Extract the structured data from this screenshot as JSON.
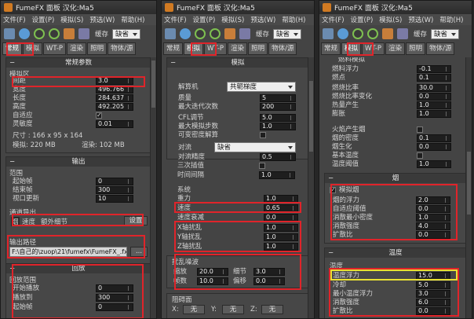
{
  "app": {
    "title": "FumeFX 面板  汉化:Ma5",
    "menus": [
      "文件(F)",
      "设置(P)",
      "模拟(S)",
      "预选(W)",
      "帮助(H)"
    ],
    "cache_label": "缓存",
    "cache_value": "缺省",
    "tabs": [
      "常规",
      "模拟",
      "WT-P",
      "渲染",
      "照明",
      "物体/源"
    ]
  },
  "panel1": {
    "header": "常规参数",
    "grid_label": "模拟区",
    "fields": [
      {
        "label": "间距",
        "value": "3.0"
      },
      {
        "label": "宽度",
        "value": "496.766"
      },
      {
        "label": "长度",
        "value": "284.637"
      },
      {
        "label": "高度",
        "value": "492.205"
      }
    ],
    "adaptive_label": "自适应",
    "sensitivity_label": "灵敏度",
    "sensitivity_value": "0.01",
    "size_text": "尺寸 : 166 x 95 x 164",
    "sim_mem": "模拟: 220 MB",
    "render_mem": "渲染: 102 MB",
    "output_header": "输出",
    "range_label": "范围",
    "range": [
      {
        "label": "起始帧",
        "value": "0"
      },
      {
        "label": "结束帧",
        "value": "300"
      },
      {
        "label": "视口更新",
        "value": "10"
      }
    ],
    "channels_label": "通道导出",
    "channels": [
      "烟",
      "速度",
      "额外细节"
    ],
    "settings_button": "设置",
    "output_path_label": "输出路径",
    "output_path": "F:\\自己的\\zuop\\21\\fumefx\\FumeFX_.fxd",
    "browse": "...",
    "playback_header": "回放",
    "playback_range_label": "回放范围",
    "playback": [
      {
        "label": "开始播放",
        "value": "0"
      },
      {
        "label": "播放到",
        "value": "300"
      },
      {
        "label": "起始帧",
        "value": "0"
      }
    ]
  },
  "panel2": {
    "header": "模拟",
    "solver_label": "解算机",
    "solver_value": "共轭梯度",
    "fields": [
      {
        "label": "质量",
        "value": "5"
      },
      {
        "label": "最大迭代次数",
        "value": "200"
      },
      {
        "label": "CFL调节",
        "value": "5.0"
      },
      {
        "label": "最大模拟步数",
        "value": "1.0"
      }
    ],
    "variable_label": "可变密度解算",
    "advect_label": "对流",
    "advect_value": "缺省",
    "advect_fields": [
      {
        "label": "对流精度",
        "value": "0.5"
      },
      {
        "label": "三次插值",
        "value": ""
      },
      {
        "label": "时间间隔",
        "value": "1.0"
      }
    ],
    "system_label": "系统",
    "system": [
      {
        "label": "重力",
        "value": "1.0"
      },
      {
        "label": "速度",
        "value": "0.65"
      },
      {
        "label": "速度衰减",
        "value": "0.0"
      },
      {
        "label": "X轴扰乱",
        "value": "1.0"
      },
      {
        "label": "Y轴扰乱",
        "value": "1.0"
      },
      {
        "label": "Z轴扰乱",
        "value": "1.0"
      }
    ],
    "turb_label": "扰乱噪波",
    "turb": [
      {
        "label": "缩放",
        "value": "20.0",
        "label2": "细节",
        "value2": "3.0"
      },
      {
        "label": "帧数",
        "value": "10.0",
        "label2": "偏移",
        "value2": "0.0"
      }
    ],
    "block_label": "阻碍面",
    "axes": [
      "X:",
      "Y:",
      "Z:"
    ],
    "axis_value": "无"
  },
  "panel3": {
    "fuel_header": "燃料模拟",
    "fuel": [
      {
        "label": "燃料浮力",
        "value": "-0.1"
      },
      {
        "label": "燃点",
        "value": "0.1"
      },
      {
        "label": "燃烧比率",
        "value": "30.0"
      },
      {
        "label": "燃烧比率变化",
        "value": "0.0"
      },
      {
        "label": "热量产生",
        "value": "1.0"
      },
      {
        "label": "膨胀",
        "value": "1.0"
      }
    ],
    "fire_label": "火焰产生烟",
    "fuel_fields2": [
      {
        "label": "烟的密度",
        "value": "0.1"
      },
      {
        "label": "烟生化",
        "value": "0.0"
      }
    ],
    "base_temp_label": "基本温度",
    "temp_thresh_label": "温度阈值",
    "temp_thresh_value": "1.0",
    "smoke_header": "烟",
    "smoke_sim_label": "模拟烟",
    "smoke": [
      {
        "label": "烟的浮力",
        "value": "2.0"
      },
      {
        "label": "自适应阈值",
        "value": "0.0"
      },
      {
        "label": "消散最小密度",
        "value": "1.0"
      },
      {
        "label": "消散强度",
        "value": "4.0"
      },
      {
        "label": "扩散比",
        "value": "0.0"
      }
    ],
    "temp_header": "温度",
    "temp_label": "温度",
    "temp": [
      {
        "label": "温度浮力",
        "value": "15.0"
      },
      {
        "label": "冷却",
        "value": "5.0"
      },
      {
        "label": "最小温度浮力",
        "value": "3.0"
      },
      {
        "label": "消散强度",
        "value": "6.0"
      },
      {
        "label": "扩散比",
        "value": "0.0"
      }
    ]
  }
}
